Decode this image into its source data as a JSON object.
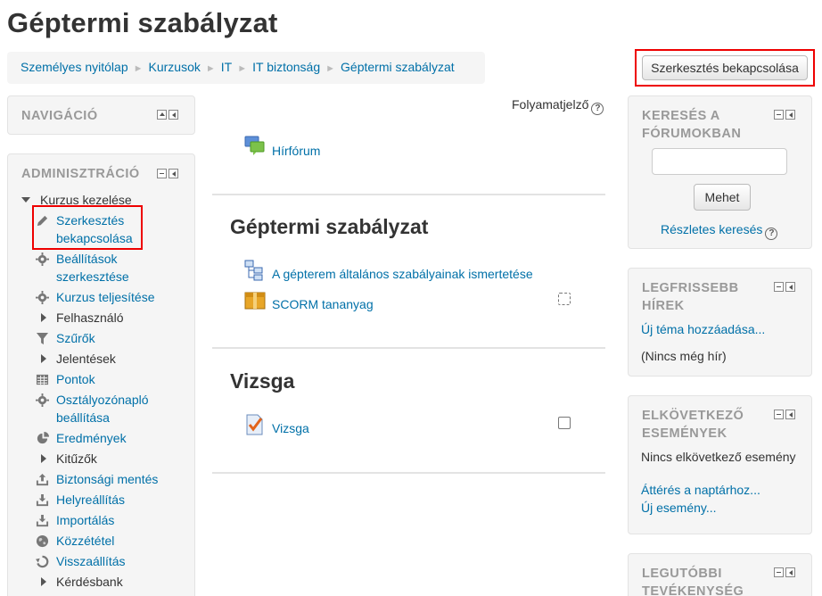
{
  "page": {
    "title": "Géptermi szabályzat"
  },
  "breadcrumb": [
    "Személyes nyitólap",
    "Kurzusok",
    "IT",
    "IT biztonság",
    "Géptermi szabályzat"
  ],
  "header": {
    "edit_button": "Szerkesztés bekapcsolása"
  },
  "navigation": {
    "title": "NAVIGÁCIÓ"
  },
  "admin": {
    "title": "ADMINISZTRÁCIÓ",
    "group": "Kurzus kezelése",
    "items": [
      {
        "label": "Szerkesztés bekapcsolása",
        "icon": "pencil-icon",
        "link": true
      },
      {
        "label": "Beállítások szerkesztése",
        "icon": "gear-icon",
        "link": true
      },
      {
        "label": "Kurzus teljesítése",
        "icon": "gear-icon",
        "link": true
      },
      {
        "label": "Felhasználó",
        "icon": "chevron-right-icon",
        "link": false
      },
      {
        "label": "Szűrők",
        "icon": "filter-icon",
        "link": true
      },
      {
        "label": "Jelentések",
        "icon": "chevron-right-icon",
        "link": false
      },
      {
        "label": "Pontok",
        "icon": "table-icon",
        "link": true
      },
      {
        "label": "Osztályozónapló beállítása",
        "icon": "gear-icon",
        "link": true
      },
      {
        "label": "Eredmények",
        "icon": "pie-icon",
        "link": true
      },
      {
        "label": "Kitűzők",
        "icon": "chevron-right-icon",
        "link": false
      },
      {
        "label": "Biztonsági mentés",
        "icon": "upload-icon",
        "link": true
      },
      {
        "label": "Helyreállítás",
        "icon": "download-icon",
        "link": true
      },
      {
        "label": "Importálás",
        "icon": "download-icon",
        "link": true
      },
      {
        "label": "Közzététel",
        "icon": "globe-icon",
        "link": true
      },
      {
        "label": "Visszaállítás",
        "icon": "reset-icon",
        "link": true
      },
      {
        "label": "Kérdésbank",
        "icon": "chevron-right-icon",
        "link": false
      }
    ]
  },
  "main": {
    "progress_label": "Folyamatjelző",
    "forum_link": "Hírfórum",
    "sections": [
      {
        "title": "Géptermi szabályzat",
        "activities": [
          {
            "label": "A gépterem általános szabályainak ismertetése",
            "icon": "book-icon"
          },
          {
            "label": "SCORM tananyag",
            "icon": "scorm-package-icon"
          }
        ]
      },
      {
        "title": "Vizsga",
        "activities": [
          {
            "label": "Vizsga",
            "icon": "quiz-icon"
          }
        ]
      }
    ]
  },
  "search_block": {
    "title_line1": "KERESÉS A",
    "title_line2": "FÓRUMOKBAN",
    "button": "Mehet",
    "advanced": "Részletes keresés"
  },
  "news_block": {
    "title_line1": "LEGFRISSEBB",
    "title_line2": "HÍREK",
    "add_topic": "Új téma hozzáadása...",
    "empty": "(Nincs még hír)"
  },
  "events_block": {
    "title_line1": "ELKÖVETKEZŐ",
    "title_line2": "ESEMÉNYEK",
    "none": "Nincs elkövetkező esemény",
    "calendar_link": "Áttérés a naptárhoz...",
    "new_event": "Új esemény..."
  },
  "recent_block": {
    "title_line1": "LEGUTÓBBI",
    "title_line2": "TEVÉKENYSÉG"
  }
}
